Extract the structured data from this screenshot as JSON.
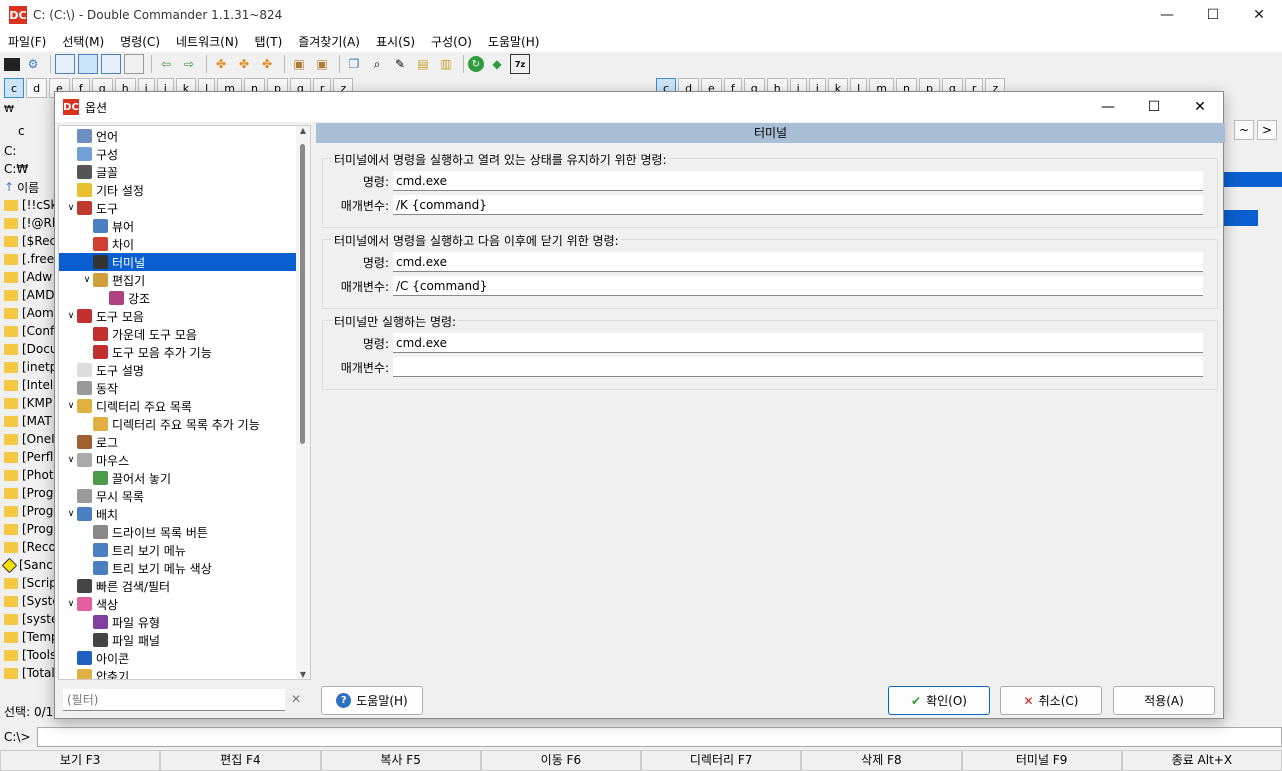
{
  "window": {
    "title": "C: (C:\\) - Double Commander 1.1.31~824",
    "logo_text": "DC",
    "minimize": "—",
    "maximize": "☐",
    "close": "✕"
  },
  "menu": [
    "파일(F)",
    "선택(M)",
    "명령(C)",
    "네트워크(N)",
    "탭(T)",
    "즐겨찾기(A)",
    "표시(S)",
    "구성(O)",
    "도움말(H)"
  ],
  "drives_left": [
    "c",
    "d",
    "e",
    "f",
    "g",
    "h",
    "i",
    "j",
    "k",
    "l",
    "m",
    "n",
    "p",
    "q",
    "r",
    "z"
  ],
  "drives_right": [
    "c",
    "d",
    "e",
    "f",
    "g",
    "h",
    "i",
    "j",
    "k",
    "l",
    "m",
    "n",
    "p",
    "q",
    "r",
    "z"
  ],
  "left_panel": {
    "drive_icon_label": "₩",
    "tab_label": "c",
    "path_drive": "C:",
    "path": "C:₩",
    "header": "이름",
    "items": [
      "[!!cSk",
      "[!@Rl",
      "[$Rec",
      "[.free",
      "[Adw",
      "[AMD",
      "[Aom",
      "[Conf",
      "[Docu",
      "[inetp",
      "[Intel",
      "[KMP",
      "[MAT",
      "[OneI",
      "[Perfl",
      "[Phot",
      "[Prog",
      "[Prog",
      "[Prog",
      "[Reco",
      "[Sanc",
      "[Scrip",
      "[Syste",
      "[syste",
      "[Temp",
      "[Tools",
      "[Total"
    ],
    "status": "선택: 0/1"
  },
  "right_panel": {
    "nav_prev": "~",
    "nav_next": ">"
  },
  "cmdline": {
    "prompt": "C:\\>"
  },
  "fkeys": [
    "보기 F3",
    "편집 F4",
    "복사 F5",
    "이동 F6",
    "디렉터리 F7",
    "삭제 F8",
    "터미널 F9",
    "종료 Alt+X"
  ],
  "dialog": {
    "logo_text": "DC",
    "title": "옵션",
    "tree": [
      {
        "label": "언어",
        "icon": "language-icon"
      },
      {
        "label": "구성",
        "icon": "config-icon"
      },
      {
        "label": "글꼴",
        "icon": "font-icon"
      },
      {
        "label": "기타 설정",
        "icon": "misc-icon"
      },
      {
        "label": "도구",
        "icon": "tools-icon"
      },
      {
        "label": "뷰어",
        "icon": "viewer-icon"
      },
      {
        "label": "차이",
        "icon": "diff-icon"
      },
      {
        "label": "터미널",
        "icon": "terminal-icon"
      },
      {
        "label": "편집기",
        "icon": "editor-icon"
      },
      {
        "label": "강조",
        "icon": "highlight-icon"
      },
      {
        "label": "도구 모음",
        "icon": "toolbar-icon"
      },
      {
        "label": "가운데 도구 모음",
        "icon": "middle-toolbar-icon"
      },
      {
        "label": "도구 모음 추가 기능",
        "icon": "toolbar-extra-icon"
      },
      {
        "label": "도구 설명",
        "icon": "tooltip-icon"
      },
      {
        "label": "동작",
        "icon": "behavior-icon"
      },
      {
        "label": "디렉터리 주요 목록",
        "icon": "hotlist-icon"
      },
      {
        "label": "디렉터리 주요 목록 추가 기능",
        "icon": "hotlist-extra-icon"
      },
      {
        "label": "로그",
        "icon": "log-icon"
      },
      {
        "label": "마우스",
        "icon": "mouse-icon"
      },
      {
        "label": "끌어서 놓기",
        "icon": "drag-drop-icon"
      },
      {
        "label": "무시 목록",
        "icon": "ignore-list-icon"
      },
      {
        "label": "배치",
        "icon": "layout-icon"
      },
      {
        "label": "드라이브 목록 버튼",
        "icon": "drive-list-icon"
      },
      {
        "label": "트리 보기 메뉴",
        "icon": "tree-menu-icon"
      },
      {
        "label": "트리 보기 메뉴 색상",
        "icon": "tree-menu-color-icon"
      },
      {
        "label": "빠른 검색/필터",
        "icon": "quick-search-icon"
      },
      {
        "label": "색상",
        "icon": "colors-icon"
      },
      {
        "label": "파일 유형",
        "icon": "file-types-icon"
      },
      {
        "label": "파일 패널",
        "icon": "file-panels-icon"
      },
      {
        "label": "아이콘",
        "icon": "icons-icon"
      },
      {
        "label": "압축기",
        "icon": "archiver-icon"
      }
    ],
    "header": "터미널",
    "groups": [
      {
        "label": "터미널에서 명령을 실행하고 열려 있는 상태를 유지하기 위한 명령:",
        "command_label": "명령:",
        "command": "cmd.exe",
        "params_label": "매개변수:",
        "params": "/K {command}"
      },
      {
        "label": "터미널에서 명령을 실행하고 다음 이후에 닫기 위한 명령:",
        "command_label": "명령:",
        "command": "cmd.exe",
        "params_label": "매개변수:",
        "params": "/C {command}"
      },
      {
        "label": "터미널만 실행하는 명령:",
        "command_label": "명령:",
        "command": "cmd.exe",
        "params_label": "매개변수:",
        "params": ""
      }
    ],
    "filter_placeholder": "(필터)",
    "help_label": "도움말(H)",
    "ok_label": "확인(O)",
    "cancel_label": "취소(C)",
    "apply_label": "적용(A)"
  }
}
